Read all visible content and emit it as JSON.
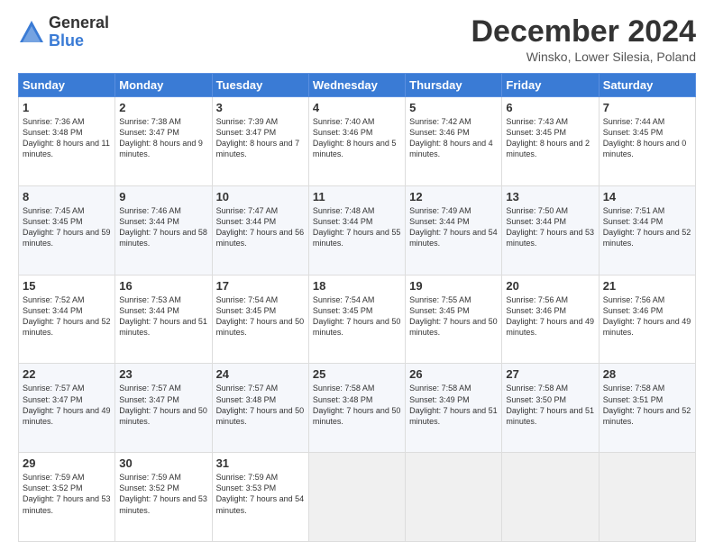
{
  "logo": {
    "general": "General",
    "blue": "Blue"
  },
  "title": "December 2024",
  "subtitle": "Winsko, Lower Silesia, Poland",
  "days_header": [
    "Sunday",
    "Monday",
    "Tuesday",
    "Wednesday",
    "Thursday",
    "Friday",
    "Saturday"
  ],
  "weeks": [
    [
      {
        "day": "1",
        "sunrise": "Sunrise: 7:36 AM",
        "sunset": "Sunset: 3:48 PM",
        "daylight": "Daylight: 8 hours and 11 minutes."
      },
      {
        "day": "2",
        "sunrise": "Sunrise: 7:38 AM",
        "sunset": "Sunset: 3:47 PM",
        "daylight": "Daylight: 8 hours and 9 minutes."
      },
      {
        "day": "3",
        "sunrise": "Sunrise: 7:39 AM",
        "sunset": "Sunset: 3:47 PM",
        "daylight": "Daylight: 8 hours and 7 minutes."
      },
      {
        "day": "4",
        "sunrise": "Sunrise: 7:40 AM",
        "sunset": "Sunset: 3:46 PM",
        "daylight": "Daylight: 8 hours and 5 minutes."
      },
      {
        "day": "5",
        "sunrise": "Sunrise: 7:42 AM",
        "sunset": "Sunset: 3:46 PM",
        "daylight": "Daylight: 8 hours and 4 minutes."
      },
      {
        "day": "6",
        "sunrise": "Sunrise: 7:43 AM",
        "sunset": "Sunset: 3:45 PM",
        "daylight": "Daylight: 8 hours and 2 minutes."
      },
      {
        "day": "7",
        "sunrise": "Sunrise: 7:44 AM",
        "sunset": "Sunset: 3:45 PM",
        "daylight": "Daylight: 8 hours and 0 minutes."
      }
    ],
    [
      {
        "day": "8",
        "sunrise": "Sunrise: 7:45 AM",
        "sunset": "Sunset: 3:45 PM",
        "daylight": "Daylight: 7 hours and 59 minutes."
      },
      {
        "day": "9",
        "sunrise": "Sunrise: 7:46 AM",
        "sunset": "Sunset: 3:44 PM",
        "daylight": "Daylight: 7 hours and 58 minutes."
      },
      {
        "day": "10",
        "sunrise": "Sunrise: 7:47 AM",
        "sunset": "Sunset: 3:44 PM",
        "daylight": "Daylight: 7 hours and 56 minutes."
      },
      {
        "day": "11",
        "sunrise": "Sunrise: 7:48 AM",
        "sunset": "Sunset: 3:44 PM",
        "daylight": "Daylight: 7 hours and 55 minutes."
      },
      {
        "day": "12",
        "sunrise": "Sunrise: 7:49 AM",
        "sunset": "Sunset: 3:44 PM",
        "daylight": "Daylight: 7 hours and 54 minutes."
      },
      {
        "day": "13",
        "sunrise": "Sunrise: 7:50 AM",
        "sunset": "Sunset: 3:44 PM",
        "daylight": "Daylight: 7 hours and 53 minutes."
      },
      {
        "day": "14",
        "sunrise": "Sunrise: 7:51 AM",
        "sunset": "Sunset: 3:44 PM",
        "daylight": "Daylight: 7 hours and 52 minutes."
      }
    ],
    [
      {
        "day": "15",
        "sunrise": "Sunrise: 7:52 AM",
        "sunset": "Sunset: 3:44 PM",
        "daylight": "Daylight: 7 hours and 52 minutes."
      },
      {
        "day": "16",
        "sunrise": "Sunrise: 7:53 AM",
        "sunset": "Sunset: 3:44 PM",
        "daylight": "Daylight: 7 hours and 51 minutes."
      },
      {
        "day": "17",
        "sunrise": "Sunrise: 7:54 AM",
        "sunset": "Sunset: 3:45 PM",
        "daylight": "Daylight: 7 hours and 50 minutes."
      },
      {
        "day": "18",
        "sunrise": "Sunrise: 7:54 AM",
        "sunset": "Sunset: 3:45 PM",
        "daylight": "Daylight: 7 hours and 50 minutes."
      },
      {
        "day": "19",
        "sunrise": "Sunrise: 7:55 AM",
        "sunset": "Sunset: 3:45 PM",
        "daylight": "Daylight: 7 hours and 50 minutes."
      },
      {
        "day": "20",
        "sunrise": "Sunrise: 7:56 AM",
        "sunset": "Sunset: 3:46 PM",
        "daylight": "Daylight: 7 hours and 49 minutes."
      },
      {
        "day": "21",
        "sunrise": "Sunrise: 7:56 AM",
        "sunset": "Sunset: 3:46 PM",
        "daylight": "Daylight: 7 hours and 49 minutes."
      }
    ],
    [
      {
        "day": "22",
        "sunrise": "Sunrise: 7:57 AM",
        "sunset": "Sunset: 3:47 PM",
        "daylight": "Daylight: 7 hours and 49 minutes."
      },
      {
        "day": "23",
        "sunrise": "Sunrise: 7:57 AM",
        "sunset": "Sunset: 3:47 PM",
        "daylight": "Daylight: 7 hours and 50 minutes."
      },
      {
        "day": "24",
        "sunrise": "Sunrise: 7:57 AM",
        "sunset": "Sunset: 3:48 PM",
        "daylight": "Daylight: 7 hours and 50 minutes."
      },
      {
        "day": "25",
        "sunrise": "Sunrise: 7:58 AM",
        "sunset": "Sunset: 3:48 PM",
        "daylight": "Daylight: 7 hours and 50 minutes."
      },
      {
        "day": "26",
        "sunrise": "Sunrise: 7:58 AM",
        "sunset": "Sunset: 3:49 PM",
        "daylight": "Daylight: 7 hours and 51 minutes."
      },
      {
        "day": "27",
        "sunrise": "Sunrise: 7:58 AM",
        "sunset": "Sunset: 3:50 PM",
        "daylight": "Daylight: 7 hours and 51 minutes."
      },
      {
        "day": "28",
        "sunrise": "Sunrise: 7:58 AM",
        "sunset": "Sunset: 3:51 PM",
        "daylight": "Daylight: 7 hours and 52 minutes."
      }
    ],
    [
      {
        "day": "29",
        "sunrise": "Sunrise: 7:59 AM",
        "sunset": "Sunset: 3:52 PM",
        "daylight": "Daylight: 7 hours and 53 minutes."
      },
      {
        "day": "30",
        "sunrise": "Sunrise: 7:59 AM",
        "sunset": "Sunset: 3:52 PM",
        "daylight": "Daylight: 7 hours and 53 minutes."
      },
      {
        "day": "31",
        "sunrise": "Sunrise: 7:59 AM",
        "sunset": "Sunset: 3:53 PM",
        "daylight": "Daylight: 7 hours and 54 minutes."
      },
      null,
      null,
      null,
      null
    ]
  ]
}
